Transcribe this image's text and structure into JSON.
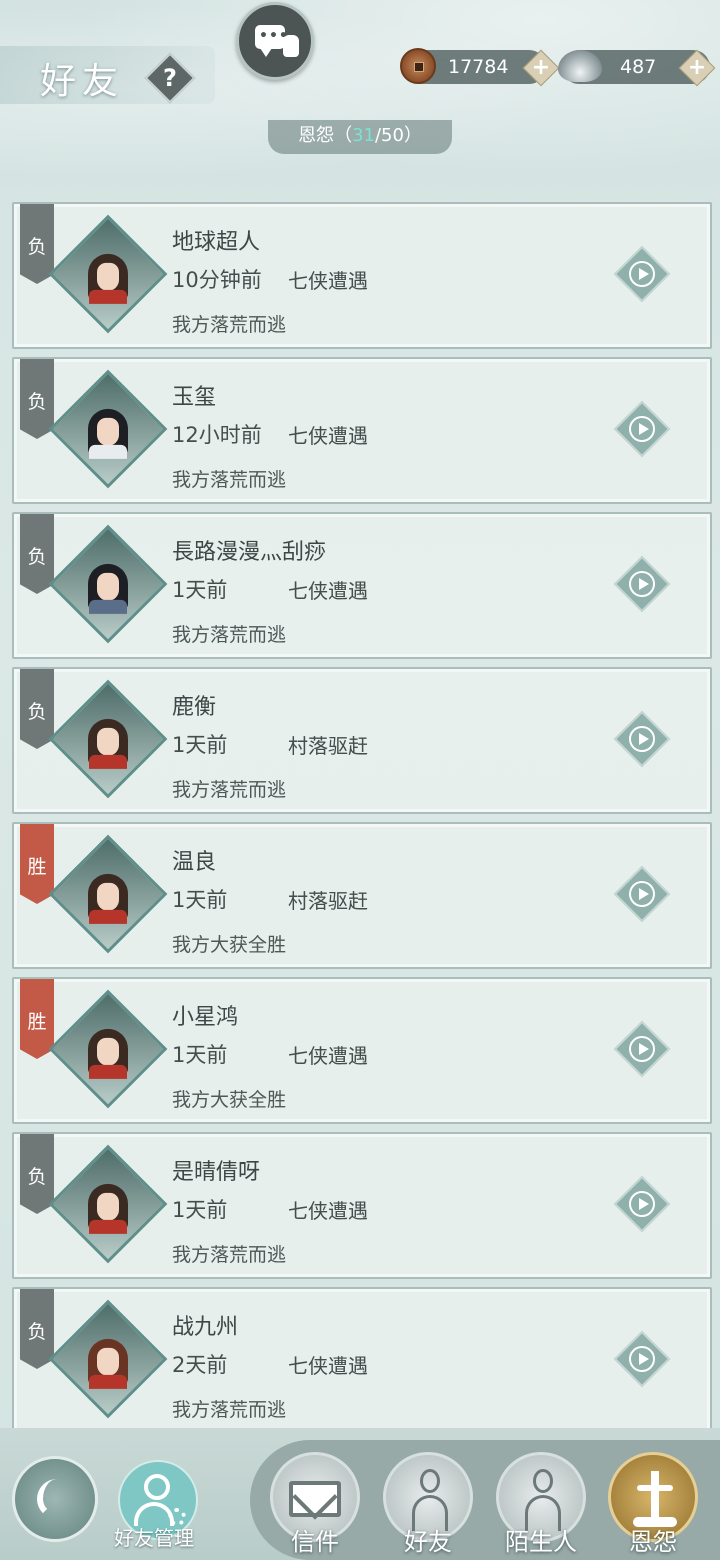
{
  "header": {
    "title": "好友",
    "help_label": "?",
    "currency": {
      "copper": "17784",
      "silver": "487",
      "plus": "+"
    },
    "section_tab": {
      "label": "恩怨",
      "open": "（",
      "current": "31",
      "sep": "/50",
      "close": "）"
    }
  },
  "records": [
    {
      "flag": "负",
      "outcome": "loss",
      "name": "地球超人",
      "time": "10分钟前",
      "mode": "七侠遭遇",
      "result": "我方落荒而逃",
      "avatar": "red-robe"
    },
    {
      "flag": "负",
      "outcome": "loss",
      "name": "玉玺",
      "time": "12小时前",
      "mode": "七侠遭遇",
      "result": "我方落荒而逃",
      "avatar": "white-robe"
    },
    {
      "flag": "负",
      "outcome": "loss",
      "name": "長路漫漫灬刮痧",
      "time": "1天前",
      "mode": "七侠遭遇",
      "result": "我方落荒而逃",
      "avatar": "black-hair-female"
    },
    {
      "flag": "负",
      "outcome": "loss",
      "name": "鹿衡",
      "time": "1天前",
      "mode": "村落驱赶",
      "result": "我方落荒而逃",
      "avatar": "red-robe"
    },
    {
      "flag": "胜",
      "outcome": "win",
      "name": "温良",
      "time": "1天前",
      "mode": "村落驱赶",
      "result": "我方大获全胜",
      "avatar": "red-robe"
    },
    {
      "flag": "胜",
      "outcome": "win",
      "name": "小星鸿",
      "time": "1天前",
      "mode": "七侠遭遇",
      "result": "我方大获全胜",
      "avatar": "red-robe"
    },
    {
      "flag": "负",
      "outcome": "loss",
      "name": "是晴倩呀",
      "time": "1天前",
      "mode": "七侠遭遇",
      "result": "我方落荒而逃",
      "avatar": "red-robe"
    },
    {
      "flag": "负",
      "outcome": "loss",
      "name": "战九州",
      "time": "2天前",
      "mode": "七侠遭遇",
      "result": "我方落荒而逃",
      "avatar": "auburn-hair"
    }
  ],
  "bottom": {
    "manage_label": "好友管理",
    "tabs": [
      {
        "label": "信件",
        "icon": "envelope-icon"
      },
      {
        "label": "好友",
        "icon": "friend-icon"
      },
      {
        "label": "陌生人",
        "icon": "stranger-icon"
      },
      {
        "label": "恩怨",
        "icon": "feud-icon",
        "active": true
      }
    ]
  },
  "colors": {
    "loss_flag": "#6f7876",
    "win_flag": "#c25a47",
    "highlight": "#7de2d2"
  }
}
